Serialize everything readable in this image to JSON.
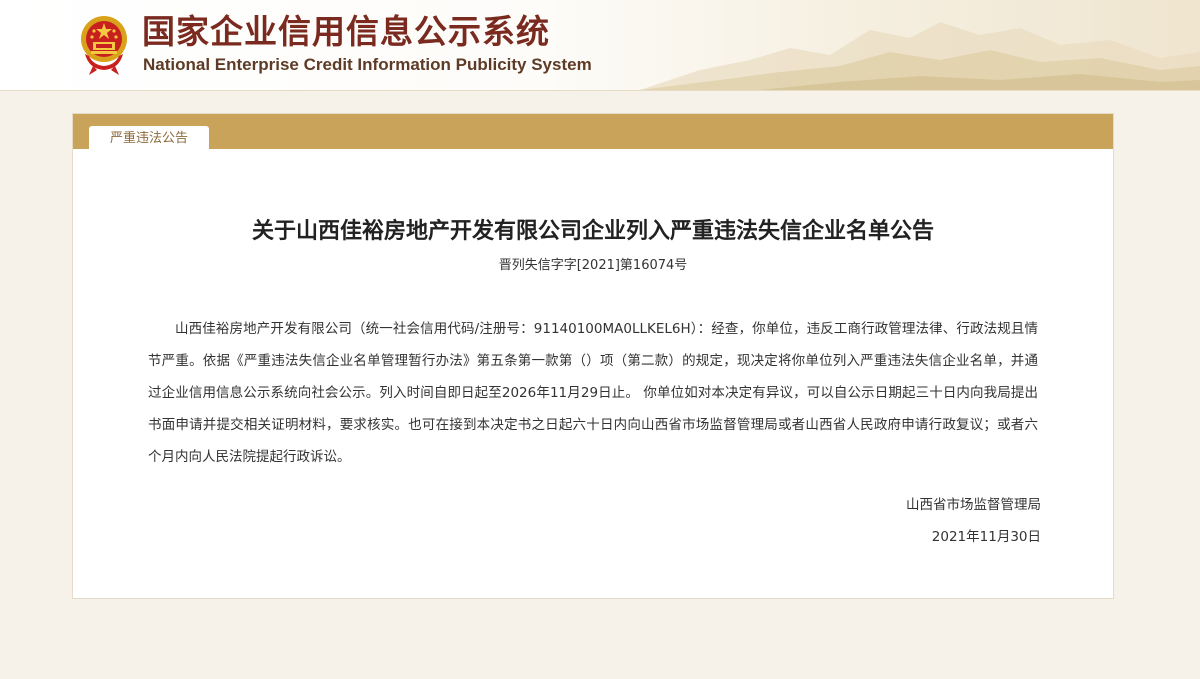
{
  "header": {
    "title_cn": "国家企业信用信息公示系统",
    "title_en": "National Enterprise Credit Information Publicity System"
  },
  "panel": {
    "tab_label": "严重违法公告"
  },
  "notice": {
    "title": "关于山西佳裕房地产开发有限公司企业列入严重违法失信企业名单公告",
    "number": "晋列失信字字[2021]第16074号",
    "body": "山西佳裕房地产开发有限公司（统一社会信用代码/注册号：91140100MA0LLKEL6H）：经查，你单位，违反工商行政管理法律、行政法规且情节严重。依据《严重违法失信企业名单管理暂行办法》第五条第一款第（）项（第二款）的规定，现决定将你单位列入严重违法失信企业名单，并通过企业信用信息公示系统向社会公示。列入时间自即日起至2026年11月29日止。 你单位如对本决定有异议，可以自公示日期起三十日内向我局提出书面申请并提交相关证明材料，要求核实。也可在接到本决定书之日起六十日内向山西省市场监督管理局或者山西省人民政府申请行政复议；或者六个月内向人民法院提起行政诉讼。",
    "authority": "山西省市场监督管理局",
    "date": "2021年11月30日"
  },
  "colors": {
    "brand_red": "#7a2a1e",
    "bar_gold": "#c9a35a",
    "page_bg": "#f6f2e9"
  }
}
